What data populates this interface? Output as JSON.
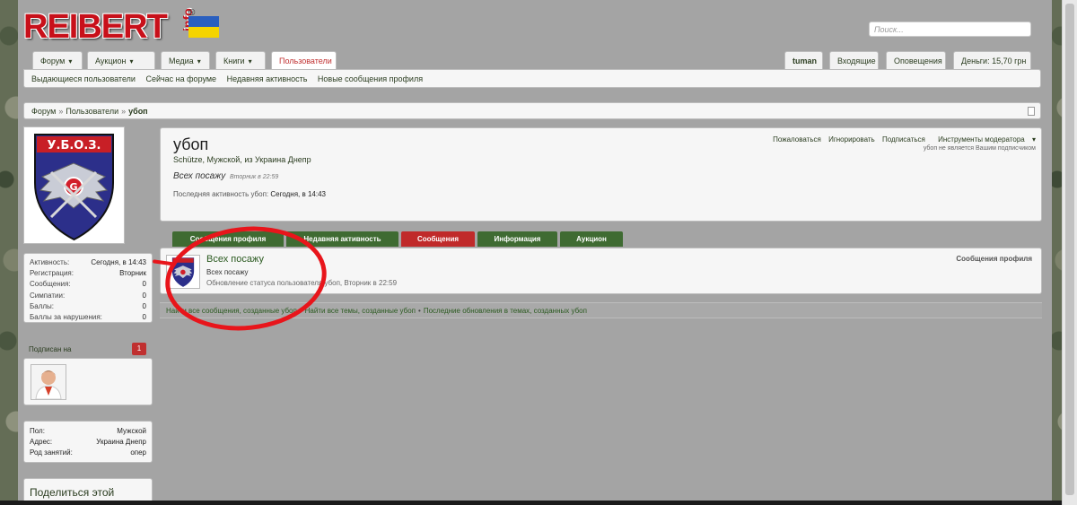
{
  "colors": {
    "accent_red": "#c03030",
    "tab_green": "#3f6b32",
    "annotation_red": "#e8151b"
  },
  "logo": {
    "text": "REIBERT",
    "suffix": "info",
    "reg": "®"
  },
  "search": {
    "placeholder": "Поиск..."
  },
  "nav": {
    "tabs": [
      {
        "label": "Форум",
        "chevron": true
      },
      {
        "label": "Аукцион",
        "chevron": true
      },
      {
        "label": "Медиа",
        "chevron": true
      },
      {
        "label": "Книги",
        "chevron": true
      },
      {
        "label": "Пользователи",
        "chevron": false,
        "active": true
      }
    ],
    "right": [
      "tuman",
      "Входящие",
      "Оповещения",
      "Деньги: 15,70 грн"
    ]
  },
  "subnav": [
    "Выдающиеся пользователи",
    "Сейчас на форуме",
    "Недавняя активность",
    "Новые сообщения профиля"
  ],
  "breadcrumb": [
    "Форум",
    "Пользователи",
    "убоп"
  ],
  "profile": {
    "name": "убоп",
    "meta": "Schütze, Мужской, из Украина Днепр",
    "status": "Всех посажу",
    "status_when": "Вторник в 22:59",
    "last_activity_label": "Последняя активность убоп:",
    "last_activity_value": "Сегодня, в 14:43",
    "actions": [
      "Пожаловаться",
      "Игнорировать",
      "Подписаться",
      "Инструменты модератора"
    ],
    "not_subscribed": "убоп не является Вашим подписчиком"
  },
  "stats": [
    {
      "k": "Активность:",
      "v": "Сегодня, в 14:43"
    },
    {
      "k": "Регистрация:",
      "v": "Вторник"
    },
    {
      "k": "Сообщения:",
      "v": "0"
    },
    {
      "k": "Симпатии:",
      "v": "0"
    },
    {
      "k": "Баллы:",
      "v": "0"
    },
    {
      "k": "Баллы за нарушения:",
      "v": "0"
    }
  ],
  "following": {
    "label": "Подписан на",
    "count": "1"
  },
  "info": [
    {
      "k": "Пол:",
      "v": "Мужской"
    },
    {
      "k": "Адрес:",
      "v": "Украина Днепр"
    },
    {
      "k": "Род занятий:",
      "v": "опер"
    }
  ],
  "share": {
    "label": "Поделиться этой"
  },
  "profile_tabs": [
    {
      "label": "Сообщения профиля",
      "color": "green"
    },
    {
      "label": "Недавняя активность",
      "color": "green"
    },
    {
      "label": "Сообщения",
      "color": "red"
    },
    {
      "label": "Информация",
      "color": "green"
    },
    {
      "label": "Аукцион",
      "color": "green"
    }
  ],
  "post": {
    "title": "Всех посажу",
    "body": "Всех посажу",
    "meta": "Обновление статуса пользователя убоп, Вторник в 22:59",
    "category": "Сообщения профиля"
  },
  "links": [
    "Найти все сообщения, созданные убоп",
    "Найти все темы, созданные убоп",
    "Последние обновления в темах, созданных убоп"
  ]
}
